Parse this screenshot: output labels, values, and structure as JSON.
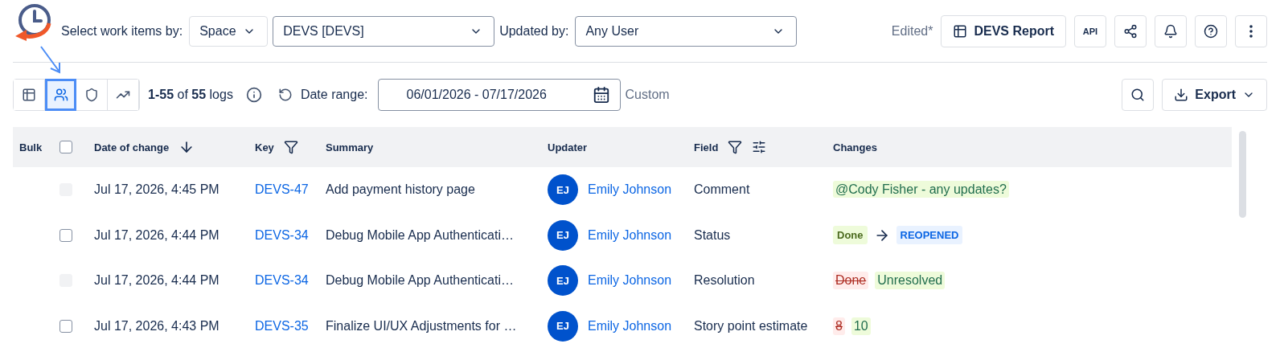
{
  "header": {
    "select_label": "Select work items by:",
    "scope": "Space",
    "project": "DEVS [DEVS]",
    "updated_label": "Updated by:",
    "user": "Any User",
    "edited": "Edited*",
    "report": "DEVS Report",
    "api": "API"
  },
  "view_buttons": [
    {
      "kind": "table",
      "selected": false
    },
    {
      "kind": "people",
      "selected": true
    },
    {
      "kind": "shield",
      "selected": false
    },
    {
      "kind": "chart",
      "selected": false
    }
  ],
  "toolbar": {
    "range": "1-55",
    "of": "of",
    "total": "55",
    "unit": "logs",
    "date_label": "Date range:",
    "date_value": "06/01/2026 - 07/17/2026",
    "custom": "Custom",
    "export": "Export"
  },
  "table": {
    "bulk_checked": false,
    "columns": [
      "Bulk",
      "Date of change",
      "Key",
      "Summary",
      "Updater",
      "Field",
      "Changes"
    ],
    "rows": [
      {
        "disabled": true,
        "checked": false,
        "date": "Jul 17, 2026, 4:45 PM",
        "key": "DEVS-47",
        "summary": "Add payment history page",
        "initials": "EJ",
        "updater": "Emily Johnson",
        "field": "Comment",
        "change": {
          "kind": "comment",
          "text": "@Cody Fisher - any updates?"
        }
      },
      {
        "disabled": false,
        "checked": false,
        "date": "Jul 17, 2026, 4:44 PM",
        "key": "DEVS-34",
        "summary": "Debug Mobile App Authenticati…",
        "initials": "EJ",
        "updater": "Emily Johnson",
        "field": "Status",
        "change": {
          "kind": "status",
          "from": "Done",
          "to": "REOPENED"
        }
      },
      {
        "disabled": true,
        "checked": false,
        "date": "Jul 17, 2026, 4:44 PM",
        "key": "DEVS-34",
        "summary": "Debug Mobile App Authenticati…",
        "initials": "EJ",
        "updater": "Emily Johnson",
        "field": "Resolution",
        "change": {
          "kind": "diff",
          "removed": "Done",
          "added": "Unresolved"
        }
      },
      {
        "disabled": false,
        "checked": false,
        "date": "Jul 17, 2026, 4:43 PM",
        "key": "DEVS-35",
        "summary": "Finalize UI/UX Adjustments for …",
        "initials": "EJ",
        "updater": "Emily Johnson",
        "field": "Story point estimate",
        "change": {
          "kind": "diff",
          "removed": "8",
          "added": "10"
        }
      }
    ]
  }
}
